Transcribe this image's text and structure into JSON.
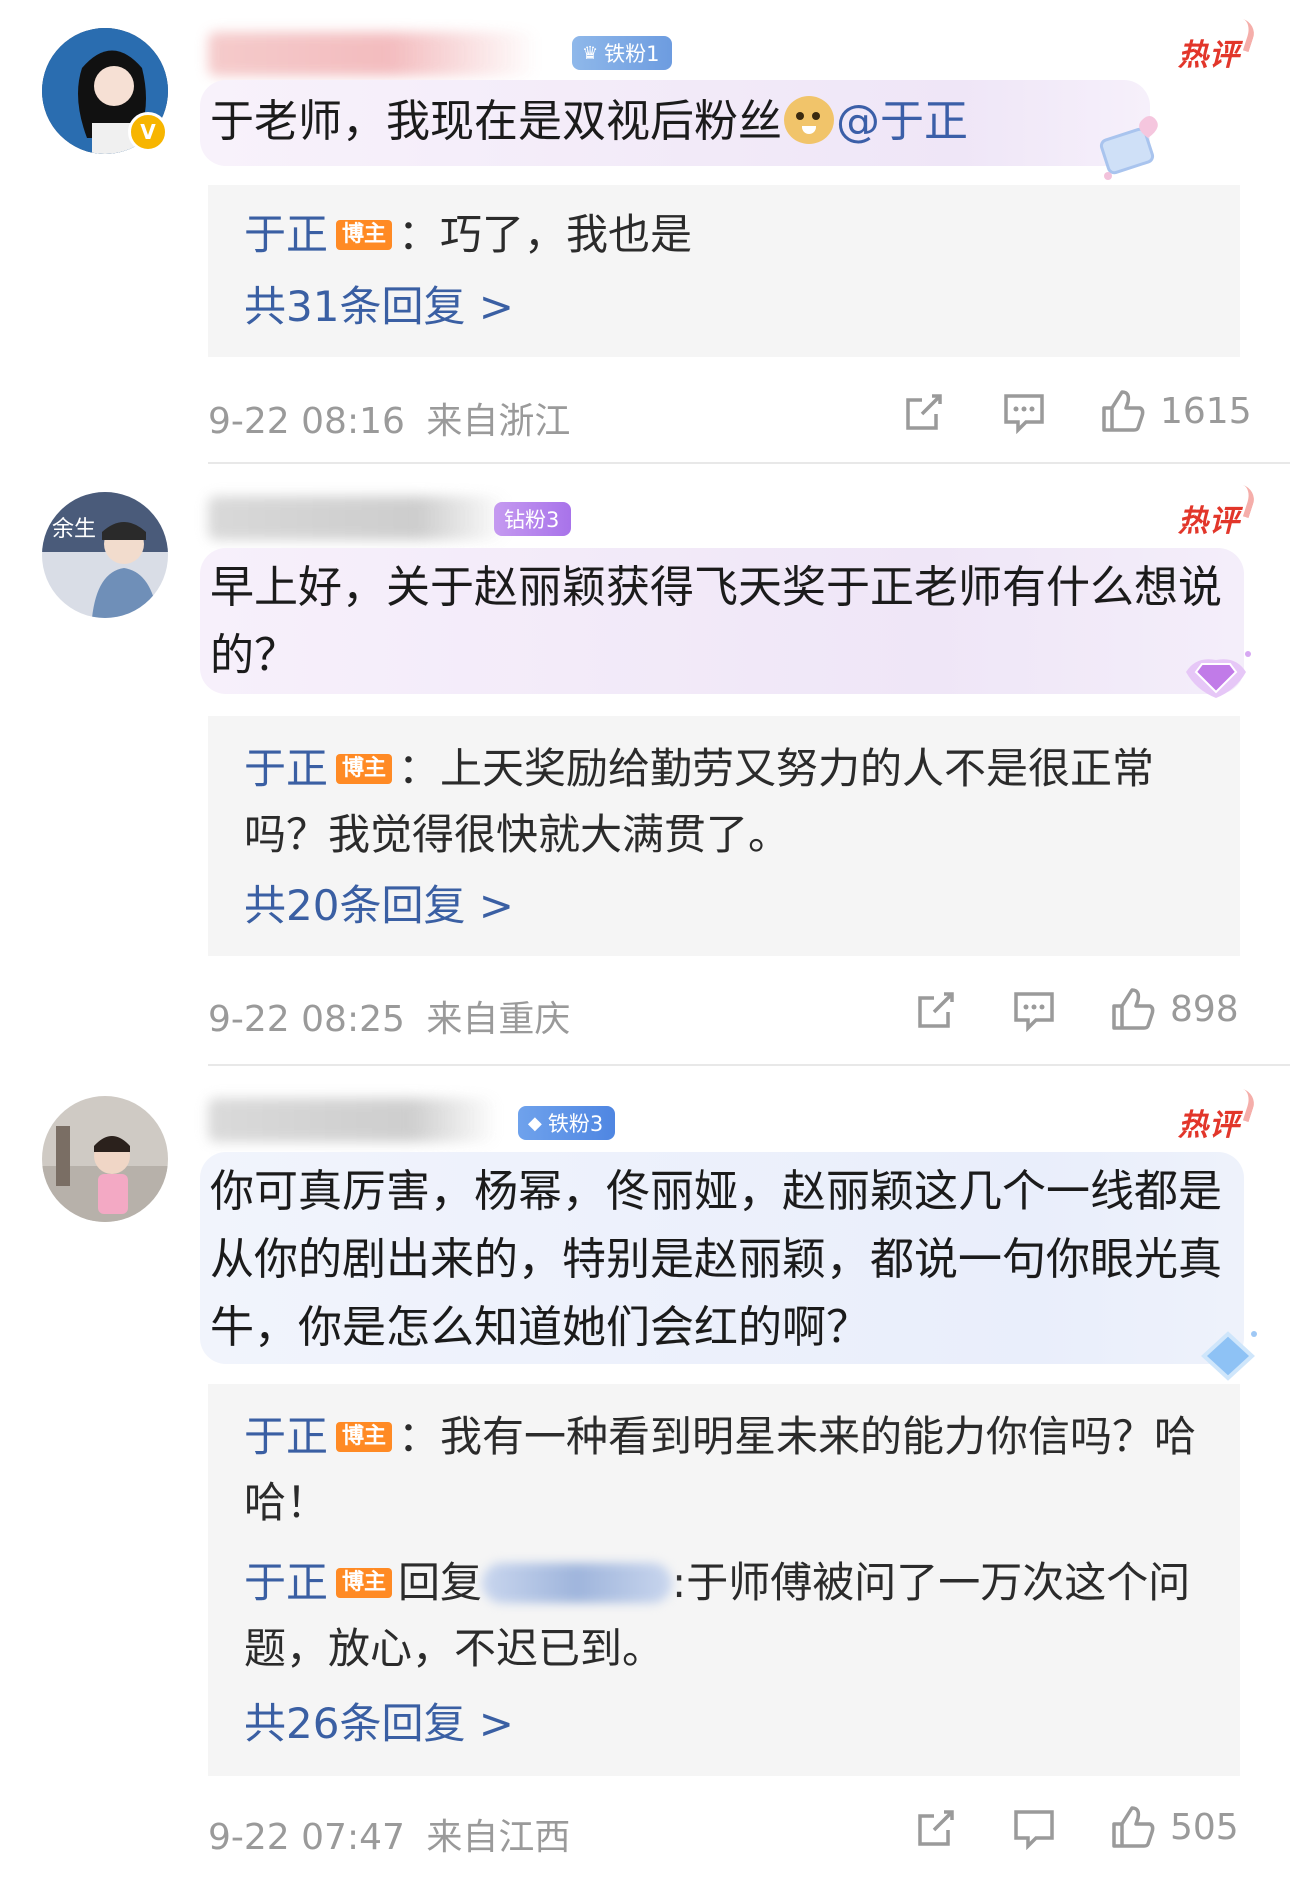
{
  "comments": [
    {
      "fan_badge": "铁粉1",
      "hot_label": "热评",
      "text": "于老师，我现在是双视后粉丝",
      "mention": "@于正",
      "replies": [
        {
          "name": "于正",
          "badge": "博主",
          "sep": "：",
          "text": "巧了，我也是"
        }
      ],
      "more": "共31条回复 >",
      "time": "9-22 08:16",
      "location": "来自浙江",
      "likes": "1615"
    },
    {
      "fan_badge": "钻粉3",
      "hot_label": "热评",
      "text": "早上好，关于赵丽颖获得飞天奖于正老师有什么想说的？",
      "replies": [
        {
          "name": "于正",
          "badge": "博主",
          "sep": "：",
          "text": "上天奖励给勤劳又努力的人不是很正常吗？我觉得很快就大满贯了。"
        }
      ],
      "more": "共20条回复 >",
      "time": "9-22 08:25",
      "location": "来自重庆",
      "likes": "898"
    },
    {
      "fan_badge": "铁粉3",
      "hot_label": "热评",
      "text": "你可真厉害，杨幂，佟丽娅，赵丽颖这几个一线都是从你的剧出来的，特别是赵丽颖，都说一句你眼光真牛，你是怎么知道她们会红的啊？",
      "replies": [
        {
          "name": "于正",
          "badge": "博主",
          "sep": "：",
          "text": "我有一种看到明星未来的能力你信吗？哈哈！"
        },
        {
          "name": "于正",
          "badge": "博主",
          "reply_word": "回复",
          "text": ":于师傅被问了一万次这个问题，放心，不迟已到。"
        }
      ],
      "more": "共26条回复 >",
      "time": "9-22 07:47",
      "location": "来自江西",
      "likes": "505"
    }
  ],
  "icons": {
    "share": "share-icon",
    "comment": "comment-icon",
    "like": "like-icon",
    "verified": "verified-icon"
  },
  "colors": {
    "link": "#3a5fa3",
    "hot": "#e2362a",
    "author_badge": "#ff8a24",
    "meta": "#9a9a9a"
  }
}
